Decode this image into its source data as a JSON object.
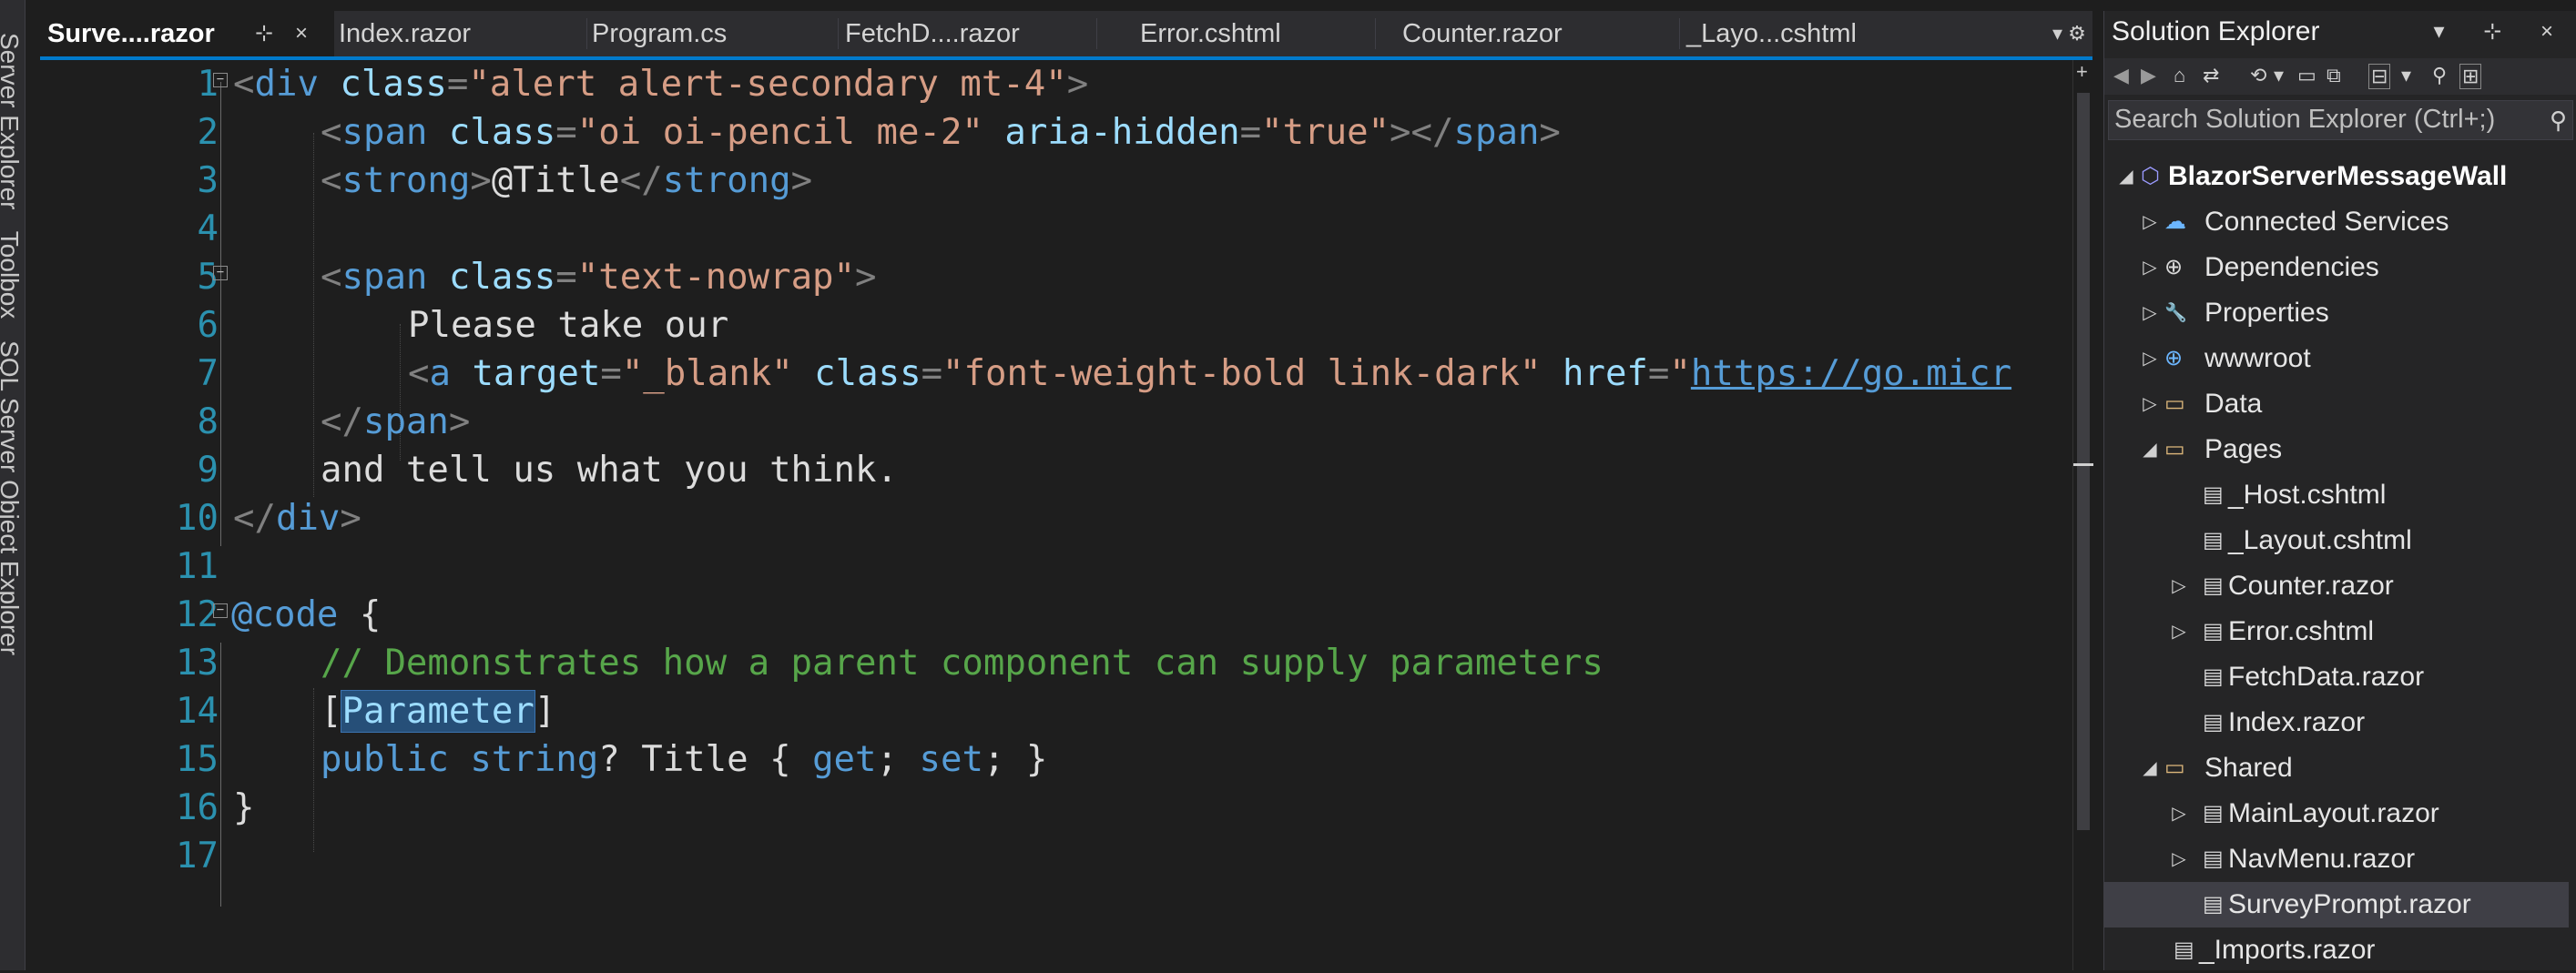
{
  "left_strip": {
    "labels": [
      "Server Explorer",
      "Toolbox",
      "SQL Server Object Explorer"
    ]
  },
  "tabs": [
    {
      "label": "Surve....razor",
      "active": true,
      "pin": "⊹",
      "close": "×"
    },
    {
      "label": "Index.razor"
    },
    {
      "label": "Program.cs"
    },
    {
      "label": "FetchD....razor"
    },
    {
      "label": "Error.cshtml"
    },
    {
      "label": "Counter.razor"
    },
    {
      "label": "_Layo...cshtml"
    }
  ],
  "tab_overflow": "▾ ⚙",
  "editor": {
    "line_numbers": [
      "1",
      "2",
      "3",
      "4",
      "5",
      "6",
      "7",
      "8",
      "9",
      "10",
      "11",
      "12",
      "13",
      "14",
      "15",
      "16",
      "17"
    ],
    "lines": {
      "l1": {
        "lt1": "<",
        "tag": "div",
        "attr": " class",
        "eq": "=",
        "val": "\"alert alert-secondary mt-4\"",
        "gt": ">"
      },
      "l2": {
        "lt1": "<",
        "tag": "span",
        "attr1": " class",
        "eq1": "=",
        "val1": "\"oi oi-pencil me-2\"",
        "attr2": " aria-hidden",
        "eq2": "=",
        "val2": "\"true\"",
        "gt": "></",
        "tag2": "span",
        "gt2": ">"
      },
      "l3": {
        "lt1": "<",
        "tag": "strong",
        "gt": ">",
        "text": "@Title",
        "lt2": "</",
        "tag2": "strong",
        "gt2": ">"
      },
      "l5": {
        "lt1": "<",
        "tag": "span",
        "attr": " class",
        "eq": "=",
        "val": "\"text-nowrap\"",
        "gt": ">"
      },
      "l6": {
        "text": "Please take our"
      },
      "l7": {
        "lt1": "<",
        "tag": "a",
        "attr1": " target",
        "eq1": "=",
        "val1": "\"_blank\"",
        "attr2": " class",
        "eq2": "=",
        "val2": "\"font-weight-bold link-dark\"",
        "attr3": " href",
        "eq3": "=",
        "q": "\"",
        "link": "https://go.micr"
      },
      "l8": {
        "lt1": "</",
        "tag": "span",
        "gt": ">"
      },
      "l9": {
        "text": "and tell us what you think."
      },
      "l10": {
        "lt1": "</",
        "tag": "div",
        "gt": ">"
      },
      "l12": {
        "kw": "@code",
        "brace": " {"
      },
      "l13": {
        "comment": "// Demonstrates how a parent component can supply parameters"
      },
      "l14": {
        "open": "[",
        "selected": "Parameter",
        "close": "]"
      },
      "l15": {
        "kw1": "public",
        "sp1": " ",
        "kw2": "string",
        "rest1": "? Title { ",
        "kw3": "get",
        "rest2": "; ",
        "kw4": "set",
        "rest3": "; }"
      },
      "l16": {
        "brace": "}"
      }
    }
  },
  "solution_explorer": {
    "title": "Solution Explorer",
    "title_icons": "▾ ⊹ ×",
    "toolbar_icons": [
      "◀",
      "▶",
      "⌂",
      "⇄",
      "⟲",
      "▾",
      "▭",
      "⧉",
      "⊟",
      "▾",
      "⚲",
      "⊞"
    ],
    "search_placeholder": "Search Solution Explorer (Ctrl+;)",
    "search_icon": "⚲",
    "nodes": [
      {
        "label": "BlazorServerMessageWall",
        "arrow": "◢",
        "icon": "⬡"
      },
      {
        "label": "Connected Services",
        "arrow": "▷",
        "icon": "☁"
      },
      {
        "label": "Dependencies",
        "arrow": "▷",
        "icon": "⊕"
      },
      {
        "label": "Properties",
        "arrow": "▷",
        "icon": "🔧"
      },
      {
        "label": "wwwroot",
        "arrow": "▷",
        "icon": "⊕"
      },
      {
        "label": "Data",
        "arrow": "▷",
        "icon": "▭"
      },
      {
        "label": "Pages",
        "arrow": "◢",
        "icon": "▭"
      },
      {
        "label": "_Host.cshtml",
        "arrow": "",
        "icon": "▤"
      },
      {
        "label": "_Layout.cshtml",
        "arrow": "",
        "icon": "▤"
      },
      {
        "label": "Counter.razor",
        "arrow": "▷",
        "icon": "▤"
      },
      {
        "label": "Error.cshtml",
        "arrow": "▷",
        "icon": "▤"
      },
      {
        "label": "FetchData.razor",
        "arrow": "",
        "icon": "▤"
      },
      {
        "label": "Index.razor",
        "arrow": "",
        "icon": "▤"
      },
      {
        "label": "Shared",
        "arrow": "◢",
        "icon": "▭"
      },
      {
        "label": "MainLayout.razor",
        "arrow": "▷",
        "icon": "▤"
      },
      {
        "label": "NavMenu.razor",
        "arrow": "▷",
        "icon": "▤"
      },
      {
        "label": "SurveyPrompt.razor",
        "arrow": "",
        "icon": "▤",
        "selected": true
      },
      {
        "label": "_Imports.razor",
        "arrow": "",
        "icon": "▤"
      }
    ]
  }
}
